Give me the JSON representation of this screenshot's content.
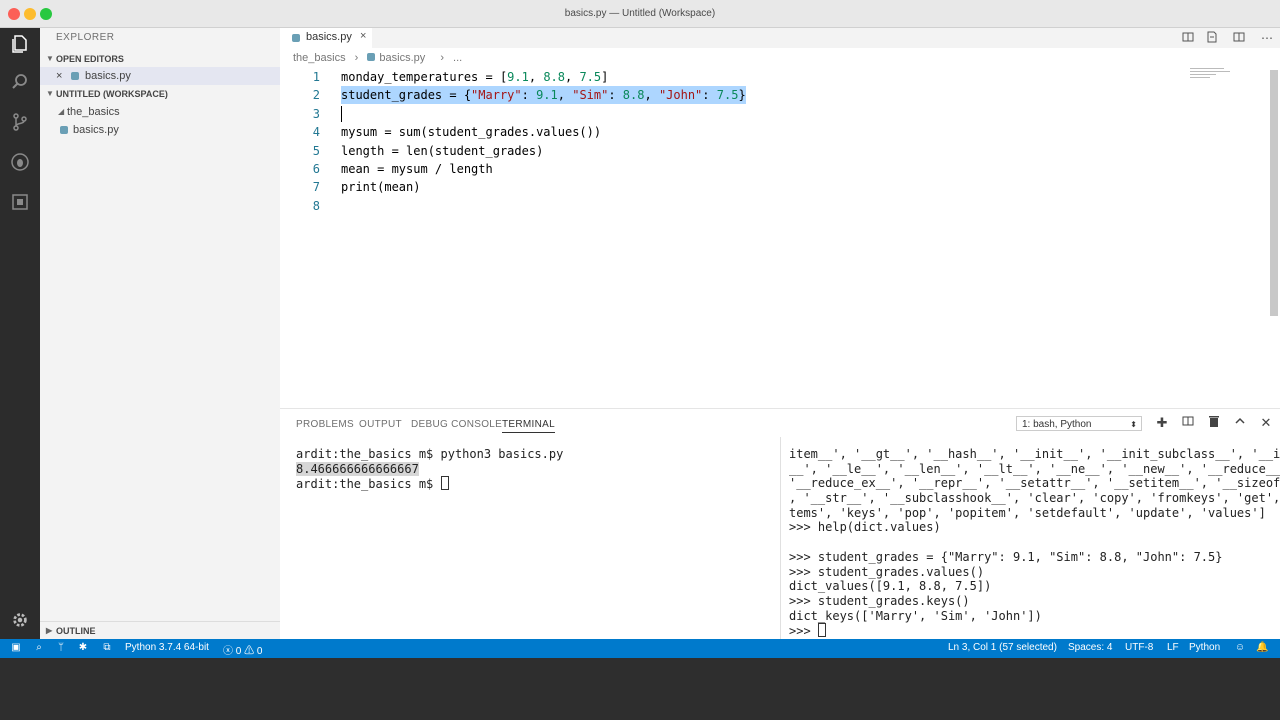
{
  "window": {
    "title": "basics.py — Untitled (Workspace)"
  },
  "sidebar": {
    "title": "EXPLORER",
    "open_editors": {
      "header": "OPEN EDITORS",
      "items": [
        {
          "label": "basics.py",
          "close": "×"
        }
      ]
    },
    "workspace": {
      "header": "UNTITLED (WORKSPACE)",
      "folder": "the_basics",
      "files": [
        "basics.py"
      ]
    },
    "outline": {
      "header": "OUTLINE"
    }
  },
  "tabs": [
    {
      "label": "basics.py",
      "close": "×"
    }
  ],
  "breadcrumb": [
    "the_basics",
    "›",
    "basics.py",
    "›",
    "..."
  ],
  "editor": {
    "lines": [
      {
        "num": "1",
        "tokens": [
          {
            "t": "monday_temperatures = [",
            "c": ""
          },
          {
            "t": "9.1",
            "c": "num"
          },
          {
            "t": ", ",
            "c": ""
          },
          {
            "t": "8.8",
            "c": "num"
          },
          {
            "t": ", ",
            "c": ""
          },
          {
            "t": "7.5",
            "c": "num"
          },
          {
            "t": "]",
            "c": ""
          }
        ]
      },
      {
        "num": "2",
        "tokens": [
          {
            "t": "student_grades = {",
            "c": ""
          },
          {
            "t": "\"Marry\"",
            "c": "str"
          },
          {
            "t": ": ",
            "c": ""
          },
          {
            "t": "9.1",
            "c": "num"
          },
          {
            "t": ", ",
            "c": ""
          },
          {
            "t": "\"Sim\"",
            "c": "str"
          },
          {
            "t": ": ",
            "c": ""
          },
          {
            "t": "8.8",
            "c": "num"
          },
          {
            "t": ", ",
            "c": ""
          },
          {
            "t": "\"John\"",
            "c": "str"
          },
          {
            "t": ": ",
            "c": ""
          },
          {
            "t": "7.5",
            "c": "num"
          },
          {
            "t": "}",
            "c": ""
          }
        ],
        "selected": true
      },
      {
        "num": "3",
        "tokens": [],
        "cursor": true
      },
      {
        "num": "4",
        "tokens": [
          {
            "t": "mysum = sum(student_grades.values())",
            "c": ""
          }
        ]
      },
      {
        "num": "5",
        "tokens": [
          {
            "t": "length = len(student_grades)",
            "c": ""
          }
        ]
      },
      {
        "num": "6",
        "tokens": [
          {
            "t": "mean = mysum / length",
            "c": ""
          }
        ]
      },
      {
        "num": "7",
        "tokens": [
          {
            "t": "print(mean)",
            "c": ""
          }
        ]
      },
      {
        "num": "8",
        "tokens": []
      }
    ]
  },
  "panel": {
    "tabs": [
      "PROBLEMS",
      "OUTPUT",
      "DEBUG CONSOLE",
      "TERMINAL"
    ],
    "active_tab": "TERMINAL",
    "terminal_select": "1: bash, Python",
    "terminal_left": [
      "ardit:the_basics m$ python3 basics.py",
      "8.466666666666667",
      "ardit:the_basics m$ "
    ],
    "terminal_right": [
      "item__', '__gt__', '__hash__', '__init__', '__init_subclass__', '__iter",
      "__', '__le__', '__len__', '__lt__', '__ne__', '__new__', '__reduce__',",
      "'__reduce_ex__', '__repr__', '__setattr__', '__setitem__', '__sizeof__'",
      ", '__str__', '__subclasshook__', 'clear', 'copy', 'fromkeys', 'get', 'i",
      "tems', 'keys', 'pop', 'popitem', 'setdefault', 'update', 'values']",
      ">>> help(dict.values)",
      "",
      ">>> student_grades = {\"Marry\": 9.1, \"Sim\": 8.8, \"John\": 7.5}",
      ">>> student_grades.values()",
      "dict_values([9.1, 8.8, 7.5])",
      ">>> student_grades.keys()",
      "dict_keys(['Marry', 'Sim', 'John'])",
      ">>> "
    ]
  },
  "statusbar": {
    "python": "Python 3.7.4 64-bit",
    "errors": "0",
    "warnings": "0",
    "position": "Ln 3, Col 1 (57 selected)",
    "spaces": "Spaces: 4",
    "encoding": "UTF-8",
    "eol": "LF",
    "language": "Python"
  },
  "colors": {
    "accent": "#007acc",
    "activity": "#2c2c2c",
    "selection": "#add6ff"
  }
}
